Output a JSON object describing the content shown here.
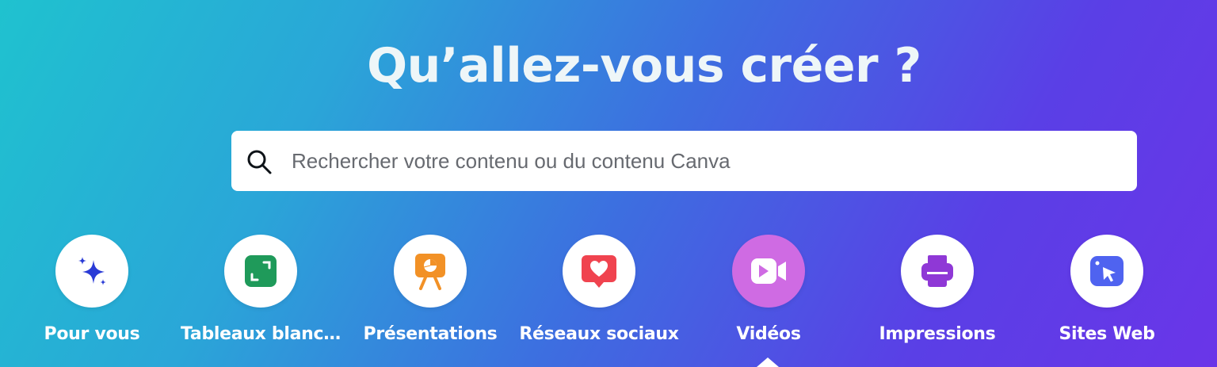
{
  "hero": {
    "title": "Qu’allez-vous créer ?"
  },
  "search": {
    "placeholder": "Rechercher votre contenu ou du contenu Canva",
    "value": "",
    "icon": "search-icon"
  },
  "categories": [
    {
      "label": "Pour vous",
      "icon": "sparkles-icon",
      "color": "#2a3bd6"
    },
    {
      "label": "Tableaux blanc…",
      "icon": "whiteboard-icon",
      "color": "#1f9a5a"
    },
    {
      "label": "Présentations",
      "icon": "presentation-icon",
      "color": "#f29126"
    },
    {
      "label": "Réseaux sociaux",
      "icon": "heart-message-icon",
      "color": "#f0434f"
    },
    {
      "label": "Vidéos",
      "icon": "video-camera-icon",
      "color": "#ffffff",
      "active": true
    },
    {
      "label": "Impressions",
      "icon": "printer-icon",
      "color": "#8f38d6"
    },
    {
      "label": "Sites Web",
      "icon": "website-cursor-icon",
      "color": "#4f63f0"
    }
  ],
  "colors": {
    "gradient_start": "#1fc2cf",
    "gradient_end": "#6a35e8",
    "active_circle": "#cf6be3"
  }
}
